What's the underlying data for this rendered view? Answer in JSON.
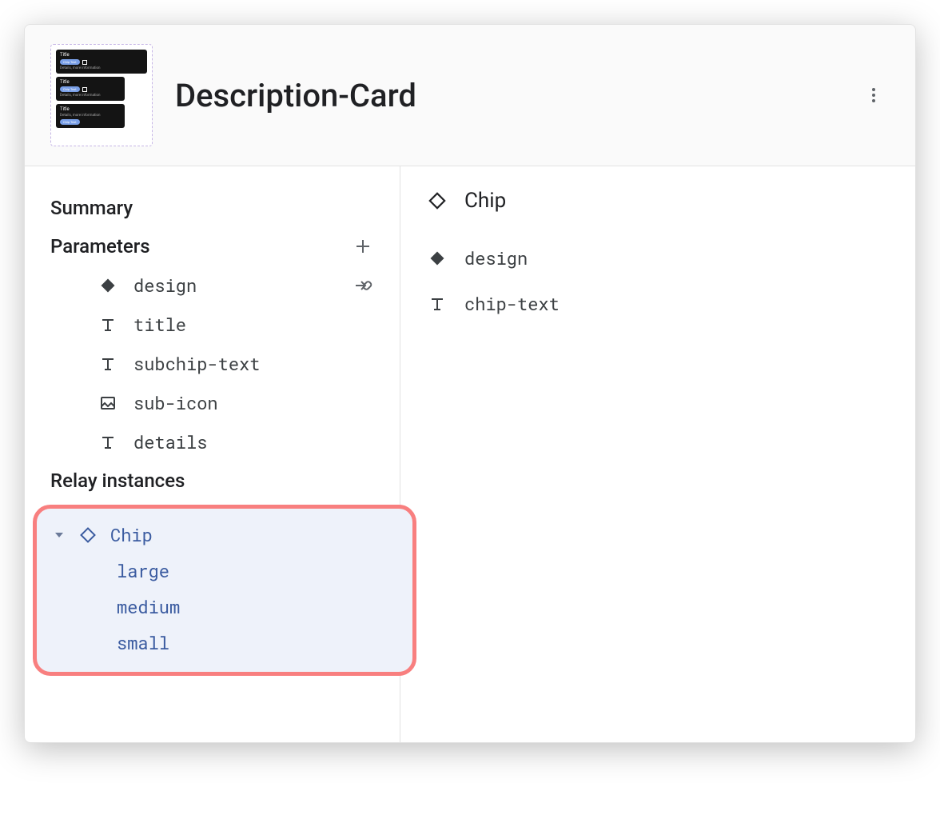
{
  "header": {
    "title": "Description-Card"
  },
  "thumb": {
    "title_text": "Title",
    "chip_text": "Chip Text",
    "details_text": "Details, more information"
  },
  "left": {
    "summary_label": "Summary",
    "parameters_label": "Parameters",
    "parameters": [
      {
        "icon": "diamond-solid",
        "name": "design",
        "trail": "map"
      },
      {
        "icon": "text",
        "name": "title"
      },
      {
        "icon": "text",
        "name": "subchip-text"
      },
      {
        "icon": "image",
        "name": "sub-icon"
      },
      {
        "icon": "text",
        "name": "details"
      }
    ],
    "relay_label": "Relay instances",
    "relay": {
      "name": "Chip",
      "variants": [
        "large",
        "medium",
        "small"
      ]
    }
  },
  "right": {
    "title": "Chip",
    "items": [
      {
        "icon": "diamond-solid",
        "name": "design"
      },
      {
        "icon": "text",
        "name": "chip-text"
      }
    ]
  }
}
